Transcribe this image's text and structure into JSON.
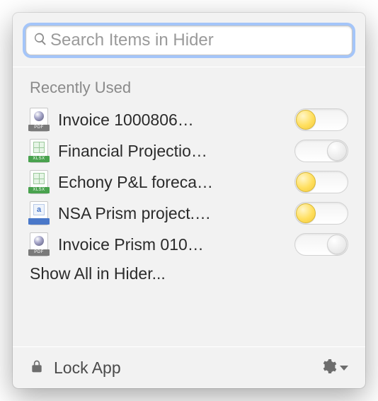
{
  "search": {
    "placeholder": "Search Items in Hider",
    "value": ""
  },
  "section_title": "Recently Used",
  "items": [
    {
      "label": "Invoice 1000806…",
      "icon": "pdf",
      "icon_tag": "PDF",
      "toggle": true
    },
    {
      "label": "Financial Projectio…",
      "icon": "xls",
      "icon_tag": "XLSX",
      "toggle": false
    },
    {
      "label": "Echony P&L foreca…",
      "icon": "xls",
      "icon_tag": "XLSX",
      "toggle": true
    },
    {
      "label": "NSA Prism project.…",
      "icon": "doc",
      "icon_tag": "",
      "toggle": true
    },
    {
      "label": "Invoice Prism 010…",
      "icon": "pdf",
      "icon_tag": "PDF",
      "toggle": false
    }
  ],
  "show_all_label": "Show All in Hider...",
  "footer": {
    "lock_label": "Lock App"
  },
  "colors": {
    "accent_toggle_on": "#ffdf5e",
    "panel_bg": "#f2f2f2",
    "focus_ring": "#79b3ff"
  }
}
